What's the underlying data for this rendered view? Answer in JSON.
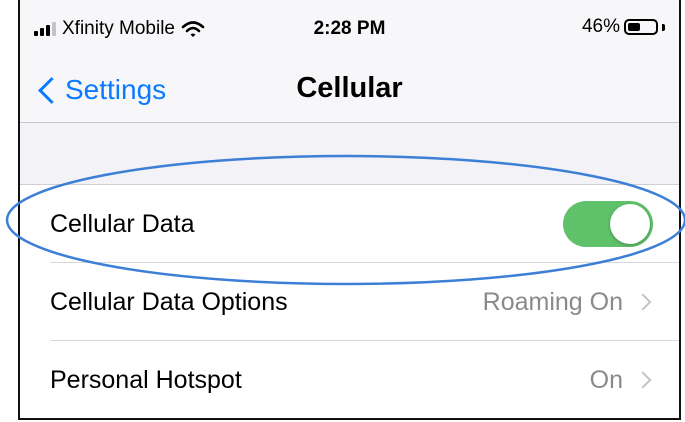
{
  "status_bar": {
    "carrier": "Xfinity Mobile",
    "time": "2:28 PM",
    "battery_percent": "46%",
    "battery_level": 0.46,
    "signal_icon": "signal-bars-icon",
    "wifi_icon": "wifi-icon"
  },
  "nav": {
    "back_label": "Settings",
    "title": "Cellular"
  },
  "rows": [
    {
      "label": "Cellular Data",
      "toggle_on": true
    },
    {
      "label": "Cellular Data Options",
      "value": "Roaming On"
    },
    {
      "label": "Personal Hotspot",
      "value": "On"
    }
  ],
  "colors": {
    "accent": "#0a7aff",
    "toggle_on": "#5fc16a",
    "annotation_ellipse": "#3d7fd6"
  }
}
